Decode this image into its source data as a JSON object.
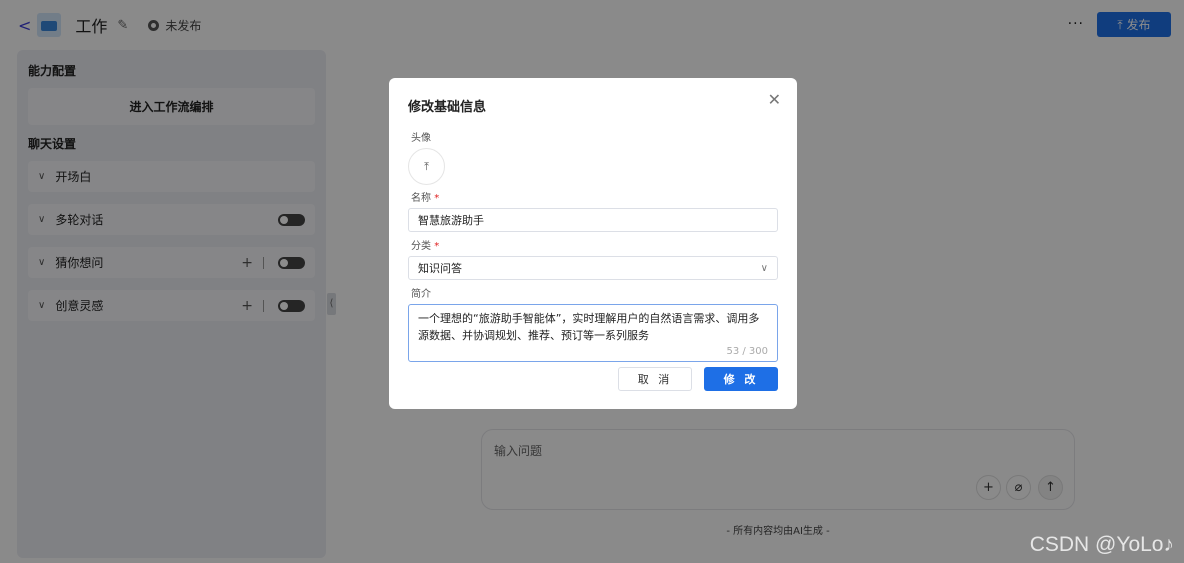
{
  "header": {
    "title": "工作",
    "status": "未发布",
    "more": "···",
    "publish": "发布"
  },
  "panel": {
    "ability_title": "能力配置",
    "workflow_button": "进入工作流编排",
    "chat_title": "聊天设置",
    "items": [
      {
        "label": "开场白"
      },
      {
        "label": "多轮对话"
      },
      {
        "label": "猜你想问"
      },
      {
        "label": "创意灵感"
      }
    ]
  },
  "chat": {
    "placeholder": "输入问题",
    "footnote": "- 所有内容均由AI生成 -"
  },
  "dialog": {
    "title": "修改基础信息",
    "avatar_label": "头像",
    "name_label": "名称",
    "name_value": "智慧旅游助手",
    "category_label": "分类",
    "category_value": "知识问答",
    "intro_label": "简介",
    "intro_value": "一个理想的“旅游助手智能体”，实时理解用户的自然语言需求、调用多源数据、并协调规划、推荐、预订等一系列服务",
    "intro_count": "53 / 300",
    "cancel": "取 消",
    "submit": "修 改",
    "required_mark": "*"
  },
  "watermark": "CSDN @YoLo♪"
}
